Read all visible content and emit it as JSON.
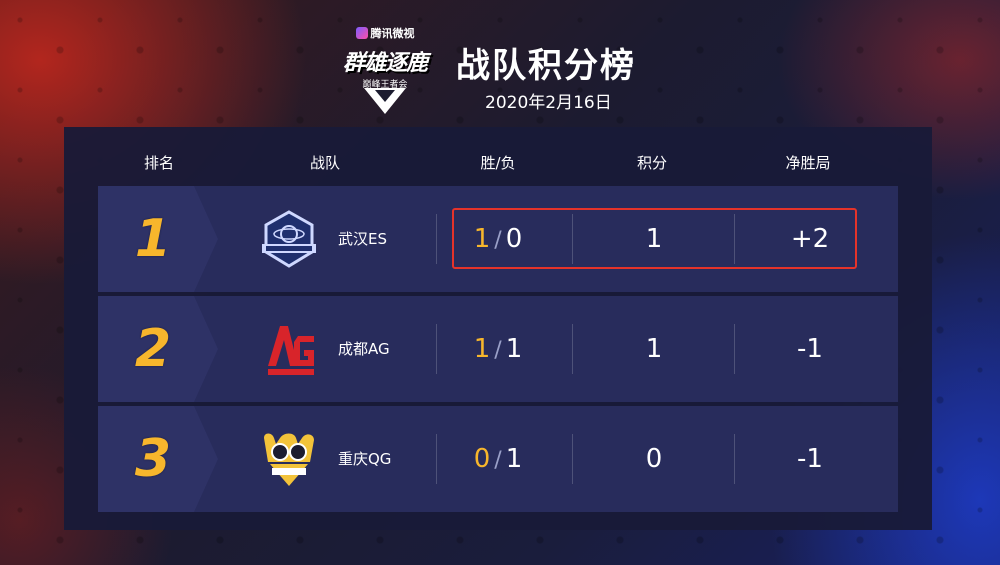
{
  "header": {
    "sponsor": "腾讯微视",
    "logo_main": "群雄逐鹿",
    "logo_sub": "巅峰王者会",
    "title": "战队积分榜",
    "date": "2020年2月16日"
  },
  "columns": {
    "rank": "排名",
    "team": "战队",
    "record": "胜/负",
    "points": "积分",
    "net": "净胜局"
  },
  "rows": [
    {
      "rank": "1",
      "team": "武汉ES",
      "logo": "estar-pro-logo",
      "wins": "1",
      "losses": "0",
      "points": "1",
      "net": "+2"
    },
    {
      "rank": "2",
      "team": "成都AG",
      "logo": "ag-logo",
      "wins": "1",
      "losses": "1",
      "points": "1",
      "net": "-1"
    },
    {
      "rank": "3",
      "team": "重庆QG",
      "logo": "qg-happy-logo",
      "wins": "0",
      "losses": "1",
      "points": "0",
      "net": "-1"
    }
  ],
  "colors": {
    "accent": "#f7b62c",
    "highlight_border": "#e5332a",
    "row_bg": "#282c5c"
  }
}
